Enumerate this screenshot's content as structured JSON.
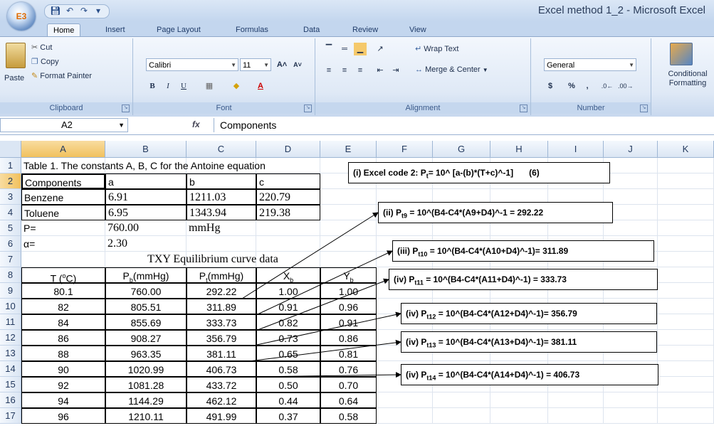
{
  "window": {
    "title": "Excel method 1_2 - Microsoft Excel"
  },
  "office_button": {
    "logo": "E3"
  },
  "qat": {
    "items": [
      "save-icon",
      "undo-icon",
      "redo-icon",
      "customize-icon"
    ]
  },
  "tabs": [
    "Home",
    "Insert",
    "Page Layout",
    "Formulas",
    "Data",
    "Review",
    "View"
  ],
  "ribbon": {
    "clipboard": {
      "paste": "Paste",
      "cut": "Cut",
      "copy": "Copy",
      "format_painter": "Format Painter",
      "label": "Clipboard"
    },
    "font": {
      "name": "Calibri",
      "size": "11",
      "label": "Font",
      "bold": "B",
      "italic": "I",
      "underline": "U"
    },
    "alignment": {
      "wrap": "Wrap Text",
      "merge": "Merge & Center",
      "label": "Alignment"
    },
    "number": {
      "format": "General",
      "currency": "$",
      "percent": "%",
      "comma": ",",
      "label": "Number"
    },
    "styles": {
      "conditional": "Conditional Formatting"
    }
  },
  "formula_bar": {
    "name_box": "A2",
    "fx": "fx",
    "value": "Components"
  },
  "columns": [
    "A",
    "B",
    "C",
    "D",
    "E",
    "F",
    "G",
    "H",
    "I",
    "J",
    "K"
  ],
  "rows": [
    "1",
    "2",
    "3",
    "4",
    "5",
    "6",
    "7",
    "8",
    "9",
    "10",
    "11",
    "12",
    "13",
    "14",
    "15",
    "16",
    "17"
  ],
  "sheet": {
    "r1": "Table 1. The constants A, B, C for the Antoine equation",
    "r2": [
      "Components",
      "a",
      "b",
      "c"
    ],
    "r3": [
      "Benzene",
      "6.91",
      "1211.03",
      "220.79"
    ],
    "r4": [
      "Toluene",
      "6.95",
      "1343.94",
      "219.38"
    ],
    "r5": [
      "P=",
      "760.00",
      "mmHg"
    ],
    "r6": [
      "α=",
      "2.30"
    ],
    "r7": "TXY Equilibrium curve data",
    "r8": [
      {
        "main": "T (",
        "sup": "o",
        "tail": "C)"
      },
      {
        "main": "P",
        "sub": "b",
        "tail": "(mmHg)"
      },
      {
        "main": "P",
        "sub": "t",
        "tail": "(mmHg)"
      },
      {
        "main": "X",
        "sub": "b",
        "tail": ""
      },
      {
        "main": "Y",
        "sub": "b",
        "tail": ""
      }
    ],
    "data": [
      [
        "80.1",
        "760.00",
        "292.22",
        "1.00",
        "1.00"
      ],
      [
        "82",
        "805.51",
        "311.89",
        "0.91",
        "0.96"
      ],
      [
        "84",
        "855.69",
        "333.73",
        "0.82",
        "0.91"
      ],
      [
        "86",
        "908.27",
        "356.79",
        "0.73",
        "0.86"
      ],
      [
        "88",
        "963.35",
        "381.11",
        "0.65",
        "0.81"
      ],
      [
        "90",
        "1020.99",
        "406.73",
        "0.58",
        "0.76"
      ],
      [
        "92",
        "1081.28",
        "433.72",
        "0.50",
        "0.70"
      ],
      [
        "94",
        "1144.29",
        "462.12",
        "0.44",
        "0.64"
      ],
      [
        "96",
        "1210.11",
        "491.99",
        "0.37",
        "0.58"
      ]
    ]
  },
  "notes": [
    {
      "prefix": "(i) Excel code 2: P",
      "sub": "t",
      "text": "= 10^ [a-(b)*(T+c)^-1]",
      "tag": "(6)"
    },
    {
      "prefix": "(ii) P",
      "sub": "t9",
      "text": " = 10^(B4-C4*(A9+D4)^-1 = 292.22"
    },
    {
      "prefix": "(iii) P",
      "sub": "t10",
      "text": " =  10^(B4-C4*(A10+D4)^-1)= 311.89"
    },
    {
      "prefix": "(iv) P",
      "sub": "t11",
      "text": " =  10^(B4-C4*(A11+D4)^-1) = 333.73"
    },
    {
      "prefix": "(iv) P",
      "sub": "t12",
      "text": " =  10^(B4-C4*(A12+D4)^-1)= 356.79"
    },
    {
      "prefix": "(iv) P",
      "sub": "t13",
      "text": " =  10^(B4-C4*(A13+D4)^-1)= 381.11"
    },
    {
      "prefix": "(iv) P",
      "sub": "t14",
      "text": " =  10^(B4-C4*(A14+D4)^-1) = 406.73"
    }
  ]
}
